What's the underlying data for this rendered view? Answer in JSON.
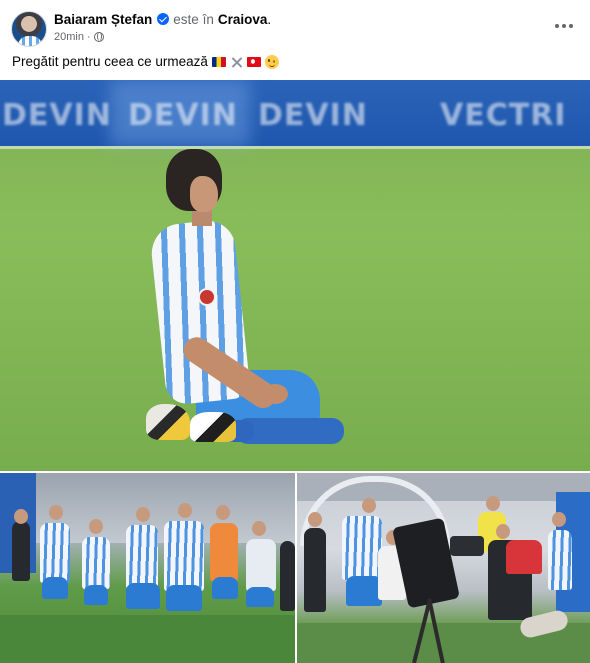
{
  "post": {
    "author": "Baiaram Ștefan",
    "location_prefix": "este în",
    "location": "Craiova",
    "location_suffix": ".",
    "time": "20min",
    "meta_separator": "·",
    "caption": "Pregătit pentru ceea ce urmează",
    "caption_emojis": [
      "romania-flag",
      "crossed-swords",
      "turkey-flag",
      "winking-face"
    ],
    "audience_icon": "globe-icon",
    "verified": true
  },
  "photos": {
    "main": {
      "banner_words": [
        "DEVIN",
        "DEVIN",
        "DEVIN",
        "VECTRI"
      ]
    }
  },
  "colors": {
    "verified_blue": "#0866ff",
    "secondary_text": "#65676b",
    "pitch_green": "#86ba58",
    "kit_blue": "#4d93e0"
  }
}
